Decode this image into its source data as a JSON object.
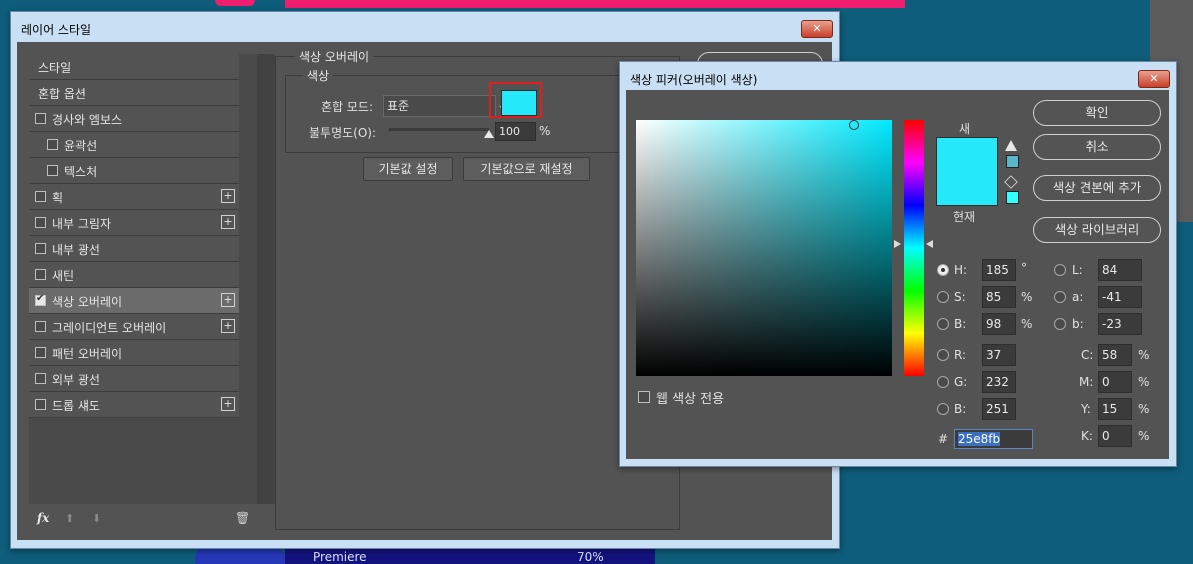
{
  "background": {
    "strip_label": "Premiere",
    "strip_value": "70%"
  },
  "layer_style": {
    "title": "레이어 스타일",
    "close_label": "✕",
    "items": [
      {
        "label": "스타일",
        "checkbox": false,
        "checked": false,
        "plus": false,
        "indent": false
      },
      {
        "label": "혼합 옵션",
        "checkbox": false,
        "checked": false,
        "plus": false,
        "indent": false
      },
      {
        "label": "경사와 엠보스",
        "checkbox": true,
        "checked": false,
        "plus": false,
        "indent": false
      },
      {
        "label": "윤곽선",
        "checkbox": true,
        "checked": false,
        "plus": false,
        "indent": true
      },
      {
        "label": "텍스처",
        "checkbox": true,
        "checked": false,
        "plus": false,
        "indent": true
      },
      {
        "label": "획",
        "checkbox": true,
        "checked": false,
        "plus": true,
        "indent": false
      },
      {
        "label": "내부 그림자",
        "checkbox": true,
        "checked": false,
        "plus": true,
        "indent": false
      },
      {
        "label": "내부 광선",
        "checkbox": true,
        "checked": false,
        "plus": false,
        "indent": false
      },
      {
        "label": "새틴",
        "checkbox": true,
        "checked": false,
        "plus": false,
        "indent": false
      },
      {
        "label": "색상 오버레이",
        "checkbox": true,
        "checked": true,
        "plus": true,
        "indent": false,
        "selected": true
      },
      {
        "label": "그레이디언트 오버레이",
        "checkbox": true,
        "checked": false,
        "plus": true,
        "indent": false
      },
      {
        "label": "패턴 오버레이",
        "checkbox": true,
        "checked": false,
        "plus": false,
        "indent": false
      },
      {
        "label": "외부 광선",
        "checkbox": true,
        "checked": false,
        "plus": false,
        "indent": false
      },
      {
        "label": "드롭 섀도",
        "checkbox": true,
        "checked": false,
        "plus": true,
        "indent": false
      }
    ],
    "plus_label": "+",
    "bottom_icons": {
      "fx": "fx",
      "up": "⬆",
      "down": "⬇",
      "trash": "🗑"
    },
    "overlay": {
      "group_title": "색상 오버레이",
      "sub_title": "색상",
      "blend_mode_label": "혼합 모드:",
      "blend_mode_value": "표준",
      "opacity_label": "불투명도(O):",
      "opacity_value": "100",
      "opacity_unit": "%",
      "opacity_level": 1.0,
      "swatch_color": "#25e8fb",
      "reset_default": "기본값 설정",
      "reset_to_default": "기본값으로 재설정"
    }
  },
  "color_picker": {
    "title": "색상 피커(오버레이 색상)",
    "close_label": "✕",
    "new_label": "새",
    "current_label": "현재",
    "new_color": "#25e8fb",
    "current_color": "#25e8fb",
    "buttons": {
      "ok": "확인",
      "cancel": "취소",
      "add_swatch": "색상 견본에 추가",
      "libraries": "색상 라이브러리"
    },
    "web_only_label": "웹 색상 전용",
    "hsb": {
      "h_label": "H:",
      "h": "185",
      "h_unit": "°",
      "s_label": "S:",
      "s": "85",
      "s_unit": "%",
      "b_label": "B:",
      "b": "98",
      "b_unit": "%"
    },
    "lab": {
      "l_label": "L:",
      "l": "84",
      "a_label": "a:",
      "a": "-41",
      "b_label": "b:",
      "b": "-23"
    },
    "rgb": {
      "r_label": "R:",
      "r": "37",
      "g_label": "G:",
      "g": "232",
      "b_label": "B:",
      "b": "251"
    },
    "cmyk": {
      "c_label": "C:",
      "c": "58",
      "m_label": "M:",
      "m": "0",
      "y_label": "Y:",
      "y": "15",
      "k_label": "K:",
      "k": "0",
      "unit": "%"
    },
    "hex_label": "#",
    "hex": "25e8fb"
  }
}
